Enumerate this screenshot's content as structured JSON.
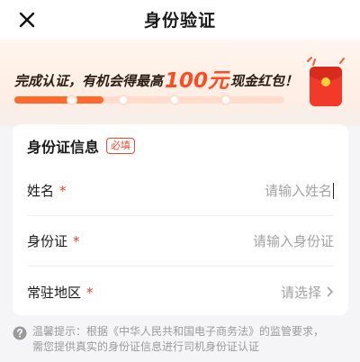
{
  "header": {
    "title": "身份验证"
  },
  "banner": {
    "promo_prefix": "完成认证，有机会得最高",
    "promo_amount": "100元",
    "promo_suffix": "现金红包！",
    "progress": 0.33
  },
  "card": {
    "title": "身份证信息",
    "required_badge": "必填",
    "fields": [
      {
        "label": "姓名",
        "required_mark": "*",
        "placeholder": "请输入姓名",
        "value": ""
      },
      {
        "label": "身份证",
        "required_mark": "*",
        "placeholder": "请输入身份证",
        "value": ""
      },
      {
        "label": "常驻地区",
        "required_mark": "*",
        "select_text": "请选择"
      }
    ]
  },
  "notice": {
    "line1": "温馨提示：根据《中华人民共和国电子商务法》的监管要求，",
    "line2": "需您提供真实的身份证信息进行司机身份证认证"
  },
  "colors": {
    "accent": "#ff6a2a",
    "amount": "#ff4b1f",
    "required": "#e8422b"
  }
}
